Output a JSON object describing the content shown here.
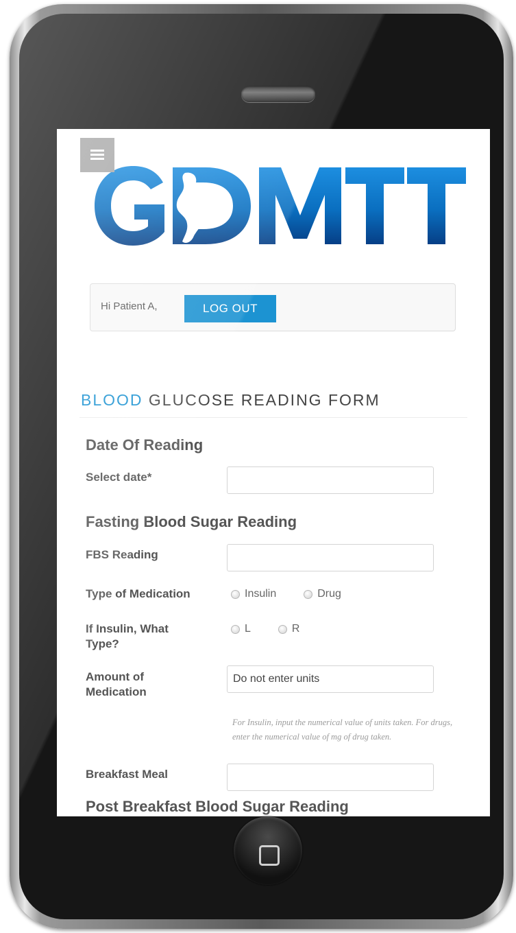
{
  "header": {
    "menu_icon": "hamburger-icon",
    "logo_text": "GDMTT"
  },
  "user": {
    "greeting": "Hi Patient A,",
    "logout_label": "LOG OUT"
  },
  "form": {
    "title_accent": "BLOOD",
    "title_rest": "GLUCOSE READING FORM",
    "sections": {
      "date": "Date Of Reading",
      "fasting": "Fasting Blood Sugar Reading",
      "post_breakfast": "Post Breakfast Blood Sugar Reading"
    },
    "fields": {
      "select_date": {
        "label": "Select date*",
        "value": ""
      },
      "fbs_reading": {
        "label": "FBS Reading",
        "value": ""
      },
      "medication_type": {
        "label": "Type of Medication",
        "options": [
          "Insulin",
          "Drug"
        ]
      },
      "insulin_type": {
        "label": "If Insulin, What Type?",
        "options": [
          "L",
          "R"
        ]
      },
      "medication_amount": {
        "label": "Amount of Medication",
        "placeholder": "Do not enter units",
        "help": "For Insulin, input the numerical value of units taken. For drugs, enter the numerical value of mg of drug taken."
      },
      "breakfast_meal": {
        "label": "Breakfast Meal",
        "value": ""
      }
    }
  },
  "colors": {
    "accent": "#1c93d2",
    "logo_blue": "#0a6fc0"
  }
}
